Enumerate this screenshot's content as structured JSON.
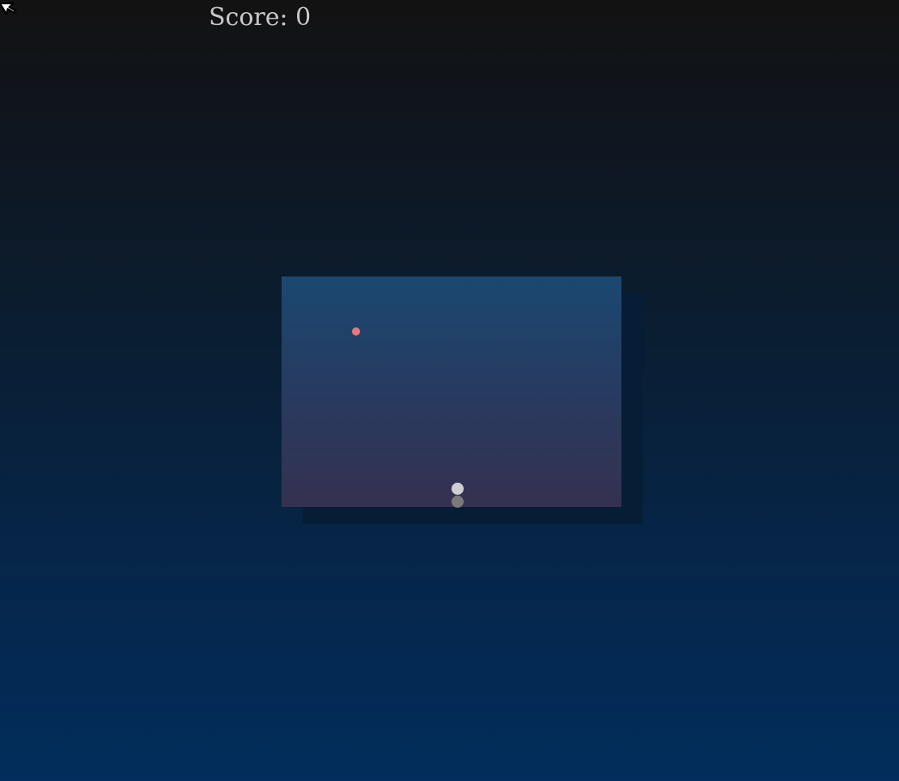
{
  "hud": {
    "score_label": "Score: 0",
    "score_value": 0
  },
  "game": {
    "food": {
      "color": "#e8787c"
    },
    "snake": {
      "head_color": "#cfcfcf",
      "body_color": "#7a7a7a",
      "segments": 2
    },
    "arena": {
      "top_color": "#1a4870",
      "bottom_color": "#353150"
    }
  },
  "icons": {
    "cursor": "cursor-icon"
  },
  "colors": {
    "background_top": "#121212",
    "background_bottom": "#022d5c",
    "score_text": "#c9c9c9"
  }
}
